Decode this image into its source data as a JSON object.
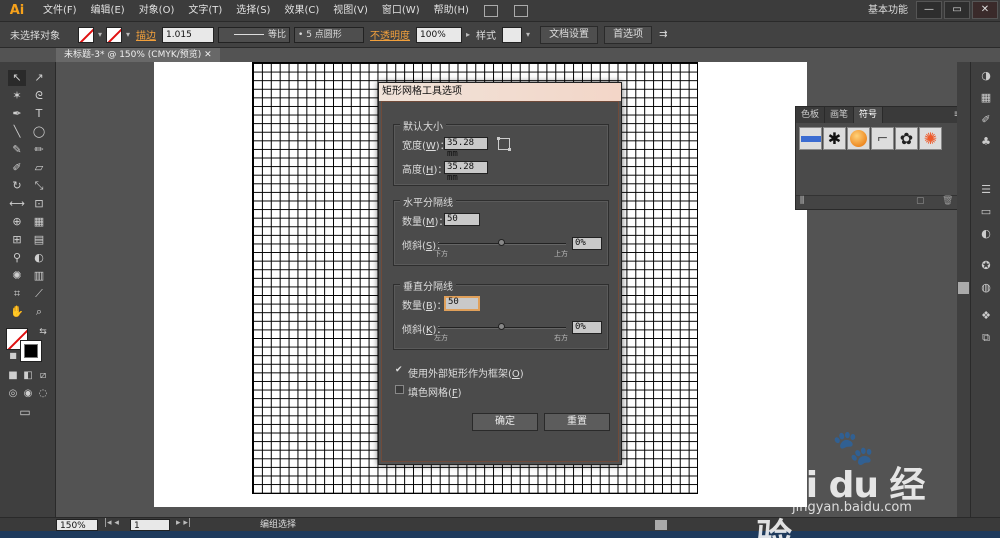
{
  "app": {
    "logo": "Ai",
    "workspace": "基本功能"
  },
  "menu": [
    "文件(F)",
    "编辑(E)",
    "对象(O)",
    "文字(T)",
    "选择(S)",
    "效果(C)",
    "视图(V)",
    "窗口(W)",
    "帮助(H)"
  ],
  "window_buttons": {
    "minimize": "—",
    "restore": "▭",
    "close": "✕"
  },
  "controlbar": {
    "selection": "未选择对象",
    "stroke_label": "描边",
    "stroke_width": "1.015",
    "stroke_profile": "等比",
    "brush": "5 点圆形",
    "opacity_label": "不透明度",
    "opacity_value": "100%",
    "style_label": "样式",
    "doc_setup": "文档设置",
    "preferences": "首选项"
  },
  "document_tab": "未标题-3* @ 150% (CMYK/预览)",
  "dialog": {
    "title": "矩形网格工具选项",
    "default_size": {
      "title": "默认大小",
      "width_label": "宽度",
      "width_key": "W",
      "width_value": "35.28 mm",
      "height_label": "高度",
      "height_key": "H",
      "height_value": "35.28 mm"
    },
    "horizontal": {
      "title": "水平分隔线",
      "count_label": "数量",
      "count_key": "M",
      "count_value": "50",
      "skew_label": "倾斜",
      "skew_key": "S",
      "skew_value": "0%",
      "skew_fraction": 0.5,
      "left_cap": "下方",
      "right_cap": "上方"
    },
    "vertical": {
      "title": "垂直分隔线",
      "count_label": "数量",
      "count_key": "B",
      "count_value": "50",
      "skew_label": "倾斜",
      "skew_key": "K",
      "skew_value": "0%",
      "skew_fraction": 0.5,
      "left_cap": "左方",
      "right_cap": "右方"
    },
    "use_outer_rect": {
      "label": "使用外部矩形作为框架",
      "key": "O",
      "checked": true
    },
    "fill_grid": {
      "label": "填色网格",
      "key": "F",
      "checked": false
    },
    "ok": "确定",
    "reset": "重置"
  },
  "symbols_panel": {
    "tabs": [
      "色板",
      "画笔",
      "符号"
    ],
    "active_tab": "符号"
  },
  "statusbar": {
    "zoom": "150%",
    "page": "1",
    "status": "编组选择"
  },
  "watermark": {
    "brand": "Bai du 经验",
    "site": "jingyan.baidu.com"
  }
}
